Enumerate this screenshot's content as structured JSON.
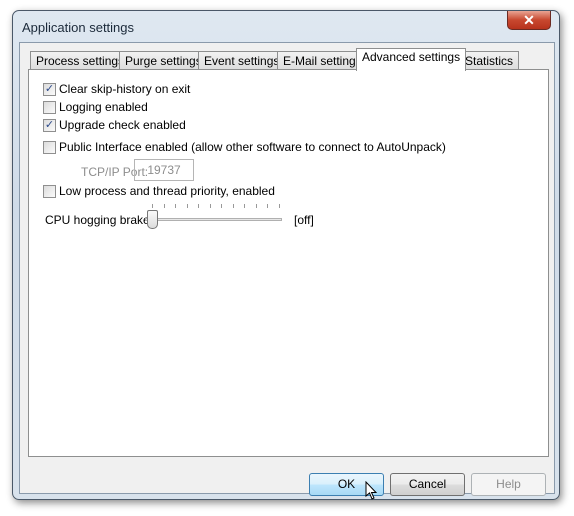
{
  "window": {
    "title": "Application settings",
    "close_icon": "close-icon"
  },
  "tabs": [
    {
      "label": "Process settings"
    },
    {
      "label": "Purge settings"
    },
    {
      "label": "Event settings"
    },
    {
      "label": "E-Mail settings"
    },
    {
      "label": "Advanced settings",
      "active": true
    },
    {
      "label": "Statistics"
    }
  ],
  "options": [
    {
      "label": "Clear skip-history on exit",
      "checked": true
    },
    {
      "label": "Logging enabled",
      "checked": false
    },
    {
      "label": "Upgrade check enabled",
      "checked": true
    },
    {
      "label": "Public Interface enabled (allow other software to connect to AutoUnpack)",
      "checked": false
    },
    {
      "label": "Low process and thread priority, enabled",
      "checked": false
    }
  ],
  "port": {
    "label": "TCP/IP Port:",
    "value": "19737"
  },
  "slider": {
    "label": "CPU hogging brake",
    "value_text": "[off]",
    "value": 0
  },
  "buttons": {
    "ok": "OK",
    "cancel": "Cancel",
    "help": "Help"
  }
}
